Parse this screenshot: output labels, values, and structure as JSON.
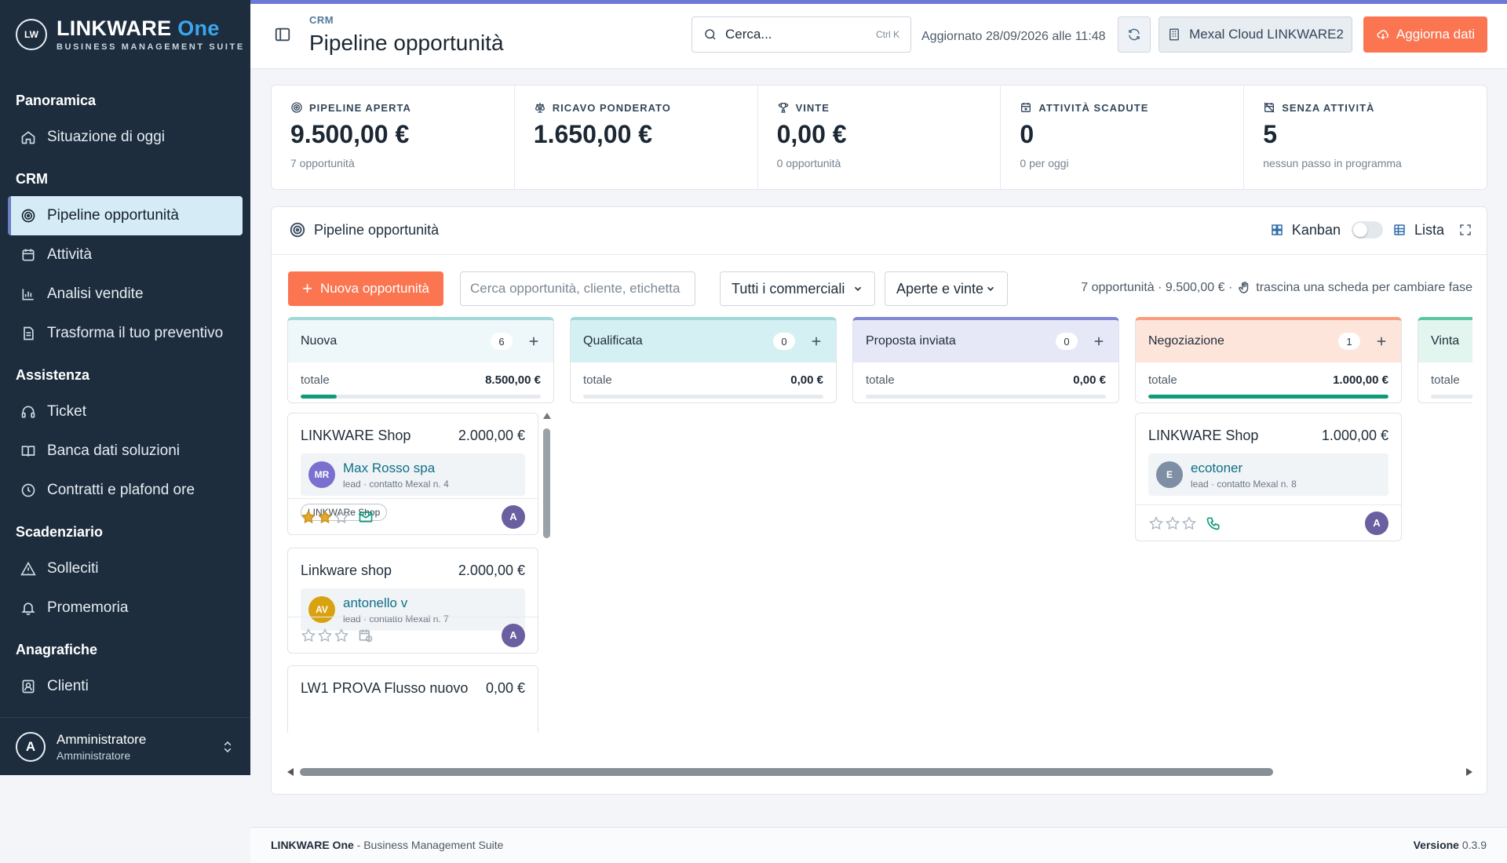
{
  "brand": {
    "logo": "LW",
    "name_main": "LINKWARE",
    "name_accent": "One",
    "subtitle": "BUSINESS MANAGEMENT SUITE"
  },
  "nav": {
    "sections": [
      {
        "title": "Panoramica",
        "items": [
          {
            "label": "Situazione di oggi",
            "icon": "home-icon"
          }
        ]
      },
      {
        "title": "CRM",
        "items": [
          {
            "label": "Pipeline opportunità",
            "icon": "target-icon",
            "active": true
          },
          {
            "label": "Attività",
            "icon": "calendar-icon"
          },
          {
            "label": "Analisi vendite",
            "icon": "bar-chart-icon"
          },
          {
            "label": "Trasforma il tuo preventivo",
            "icon": "document-icon"
          }
        ]
      },
      {
        "title": "Assistenza",
        "items": [
          {
            "label": "Ticket",
            "icon": "headset-icon"
          },
          {
            "label": "Banca dati soluzioni",
            "icon": "book-icon"
          },
          {
            "label": "Contratti e plafond ore",
            "icon": "clock-icon"
          }
        ]
      },
      {
        "title": "Scadenziario",
        "items": [
          {
            "label": "Solleciti",
            "icon": "warning-icon"
          },
          {
            "label": "Promemoria",
            "icon": "bell-icon"
          }
        ]
      },
      {
        "title": "Anagrafiche",
        "items": [
          {
            "label": "Clienti",
            "icon": "contact-icon"
          }
        ]
      }
    ]
  },
  "user": {
    "initial": "A",
    "name": "Amministratore",
    "role": "Amministratore"
  },
  "header": {
    "breadcrumb": "CRM",
    "title": "Pipeline opportunità",
    "search_placeholder": "Cerca...",
    "search_shortcut": "Ctrl K",
    "updated": "Aggiornato 28/09/2026 alle 11:48",
    "mexal_label": "Mexal Cloud LINKWARE2",
    "update_label": "Aggiorna dati"
  },
  "kpis": [
    {
      "label": "PIPELINE APERTA",
      "value": "9.500,00 €",
      "sub": "7 opportunità",
      "icon": "target-icon"
    },
    {
      "label": "RICAVO PONDERATO",
      "value": "1.650,00 €",
      "sub": "",
      "icon": "scale-icon"
    },
    {
      "label": "VINTE",
      "value": "0,00 €",
      "sub": "0 opportunità",
      "icon": "trophy-icon"
    },
    {
      "label": "ATTIVITÀ SCADUTE",
      "value": "0",
      "sub": "0 per oggi",
      "icon": "calendar-x-icon"
    },
    {
      "label": "SENZA ATTIVITÀ",
      "value": "5",
      "sub": "nessun passo in programma",
      "icon": "calendar-off-icon"
    }
  ],
  "panel": {
    "title": "Pipeline opportunità",
    "view_kanban": "Kanban",
    "view_list": "Lista",
    "new_button": "Nuova opportunità",
    "search_placeholder": "Cerca opportunità, cliente, etichetta",
    "filter_sales": "Tutti i commerciali",
    "filter_status": "Aperte e vinte",
    "summary": "7 opportunità · 9.500,00 € ·",
    "drag_hint": "trascina una scheda per cambiare fase"
  },
  "columns": [
    {
      "name": "Nuova",
      "count": "6",
      "total_label": "totale",
      "total": "8.500,00 €",
      "progress": 0.15,
      "color": "#9fd9d8",
      "head_bg": "#eef7fa",
      "bar": "#0f9b7a"
    },
    {
      "name": "Qualificata",
      "count": "0",
      "total_label": "totale",
      "total": "0,00 €",
      "progress": 0,
      "color": "#9fd9d8",
      "head_bg": "#d4f0f3",
      "bar": "#0f9b7a"
    },
    {
      "name": "Proposta inviata",
      "count": "0",
      "total_label": "totale",
      "total": "0,00 €",
      "progress": 0,
      "color": "#7f87d6",
      "head_bg": "#e6e8f7",
      "bar": "#0f9b7a"
    },
    {
      "name": "Negoziazione",
      "count": "1",
      "total_label": "totale",
      "total": "1.000,00 €",
      "progress": 1,
      "color": "#fb9c7e",
      "head_bg": "#fde5dc",
      "bar": "#0f9b7a"
    },
    {
      "name": "Vinta",
      "count": "",
      "total_label": "totale",
      "total": "",
      "progress": 0,
      "color": "#5ac7a2",
      "head_bg": "#e2f5ee",
      "bar": "#0f9b7a"
    }
  ],
  "cards": {
    "nuova": [
      {
        "title": "LINKWARE Shop",
        "amount": "2.000,00 €",
        "contact_initials": "MR",
        "contact_color": "#7b6fcf",
        "contact_name": "Max Rosso spa",
        "contact_sub": "lead · contatto Mexal n. 4",
        "tag": "LINKWARe Shop",
        "stars": 2,
        "activity_icon": "mail-icon",
        "owner": "A"
      },
      {
        "title": "Linkware shop",
        "amount": "2.000,00 €",
        "contact_initials": "AV",
        "contact_color": "#d9a211",
        "contact_name": "antonello v",
        "contact_sub": "lead · contatto Mexal n. 7",
        "tag": "",
        "stars": 0,
        "activity_icon": "calendar-clock-icon",
        "owner": "A"
      },
      {
        "title": "LW1 PROVA Flusso nuovo",
        "amount": "0,00 €"
      }
    ],
    "negoziazione": [
      {
        "title": "LINKWARE Shop",
        "amount": "1.000,00 €",
        "contact_initials": "E",
        "contact_color": "#7e8ea3",
        "contact_name": "ecotoner",
        "contact_sub": "lead · contatto Mexal n. 8",
        "tag": "",
        "stars": 0,
        "activity_icon": "phone-icon",
        "owner": "A"
      }
    ]
  },
  "footer": {
    "brand": "LINKWARE One",
    "suffix": " - Business Management Suite",
    "version_label": "Versione",
    "version": "0.3.9"
  }
}
